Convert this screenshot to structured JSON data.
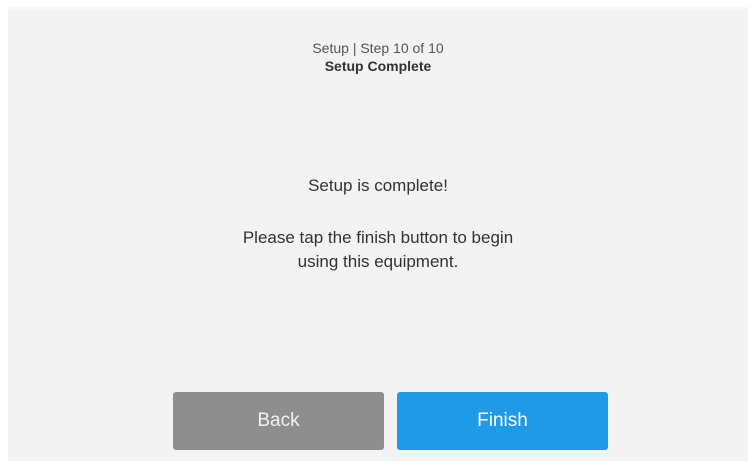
{
  "header": {
    "step_text": "Setup | Step 10 of 10",
    "title": "Setup Complete"
  },
  "message": {
    "line1": "Setup is complete!",
    "line2a": "Please tap the finish button to begin",
    "line2b": "using this equipment."
  },
  "buttons": {
    "back_label": "Back",
    "finish_label": "Finish"
  },
  "colors": {
    "background": "#f3f3f3",
    "back_button": "#8e8e8e",
    "finish_button": "#1e9ae6"
  }
}
